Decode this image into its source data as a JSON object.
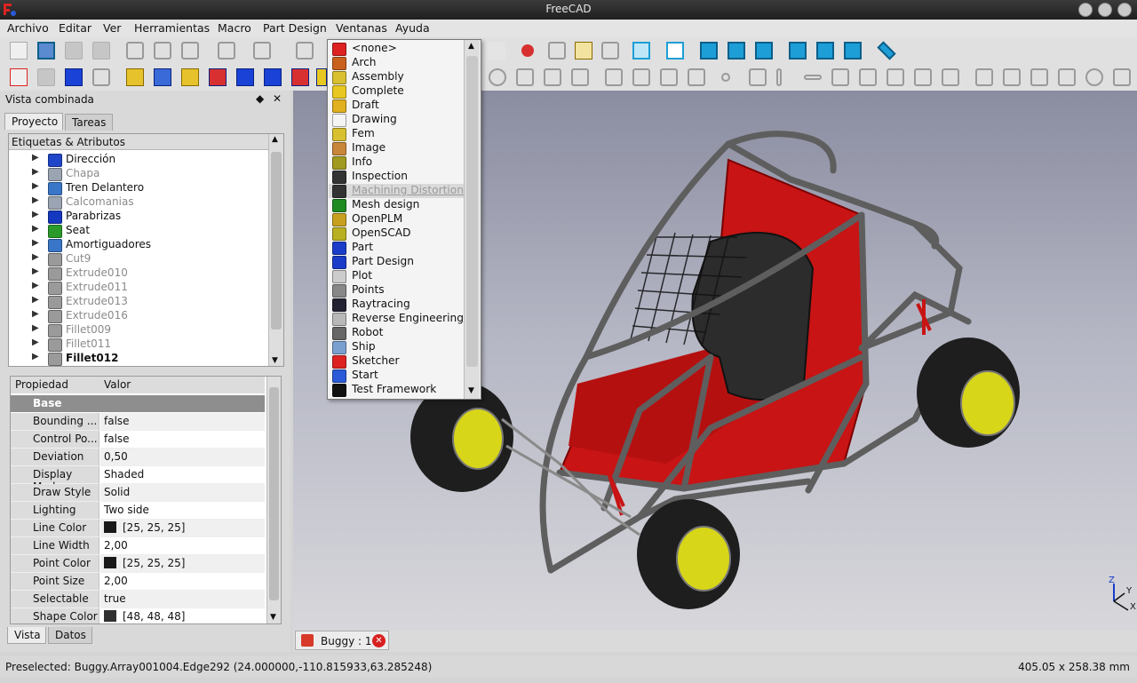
{
  "window": {
    "title": "FreeCAD"
  },
  "menubar": [
    "Archivo",
    "Editar",
    "Ver",
    "Herramientas",
    "Macro",
    "Part Design",
    "Ventanas",
    "Ayuda"
  ],
  "combo": {
    "title": "Vista combinada",
    "tabs": [
      "Proyecto",
      "Tareas"
    ],
    "tree_header": "Etiquetas & Atributos",
    "tree_items": [
      {
        "label": "Dirección",
        "icon_color": "#1f45c8",
        "dim": false
      },
      {
        "label": "Chapa",
        "icon_color": "#9aa4b2",
        "dim": true
      },
      {
        "label": "Tren Delantero",
        "icon_color": "#3a76c8",
        "dim": false
      },
      {
        "label": "Calcomanias",
        "icon_color": "#9aa4b2",
        "dim": true
      },
      {
        "label": "Parabrizas",
        "icon_color": "#1538c0",
        "dim": false
      },
      {
        "label": "Seat",
        "icon_color": "#2a9a2a",
        "dim": false
      },
      {
        "label": "Amortiguadores",
        "icon_color": "#3a76c8",
        "dim": false
      },
      {
        "label": "Cut9",
        "icon_color": "#9a9a9a",
        "dim": true
      },
      {
        "label": "Extrude010",
        "icon_color": "#9a9a9a",
        "dim": true
      },
      {
        "label": "Extrude011",
        "icon_color": "#9a9a9a",
        "dim": true
      },
      {
        "label": "Extrude013",
        "icon_color": "#9a9a9a",
        "dim": true
      },
      {
        "label": "Extrude016",
        "icon_color": "#9a9a9a",
        "dim": true
      },
      {
        "label": "Fillet009",
        "icon_color": "#9a9a9a",
        "dim": true
      },
      {
        "label": "Fillet011",
        "icon_color": "#9a9a9a",
        "dim": true
      },
      {
        "label": "Fillet012",
        "icon_color": "#9a9a9a",
        "dim": false,
        "bold": true
      }
    ],
    "prop_headers": [
      "Propiedad",
      "Valor"
    ],
    "prop_group": "Base",
    "props": [
      {
        "key": "Bounding ...",
        "value": "false"
      },
      {
        "key": "Control Po...",
        "value": "false"
      },
      {
        "key": "Deviation",
        "value": "0,50"
      },
      {
        "key": "Display Mode",
        "value": "Shaded"
      },
      {
        "key": "Draw Style",
        "value": "Solid"
      },
      {
        "key": "Lighting",
        "value": "Two side"
      },
      {
        "key": "Line Color",
        "value": "[25, 25, 25]",
        "swatch": "#191919"
      },
      {
        "key": "Line Width",
        "value": "2,00"
      },
      {
        "key": "Point Color",
        "value": "[25, 25, 25]",
        "swatch": "#191919"
      },
      {
        "key": "Point Size",
        "value": "2,00"
      },
      {
        "key": "Selectable",
        "value": "true"
      },
      {
        "key": "Shape Color",
        "value": "[48, 48, 48]",
        "swatch": "#303030"
      }
    ],
    "bottom_tabs": [
      "Vista",
      "Datos"
    ]
  },
  "workbench_dropdown": {
    "items": [
      "<none>",
      "Arch",
      "Assembly",
      "Complete",
      "Draft",
      "Drawing",
      "Fem",
      "Image",
      "Info",
      "Inspection",
      "Machining Distortion",
      "Mesh design",
      "OpenPLM",
      "OpenSCAD",
      "Part",
      "Part Design",
      "Plot",
      "Points",
      "Raytracing",
      "Reverse Engineering",
      "Robot",
      "Ship",
      "Sketcher",
      "Start",
      "Test Framework"
    ],
    "icon_colors": [
      "#d22",
      "#c8621e",
      "#d8c030",
      "#e8c820",
      "#e0b020",
      "#f4f4f4",
      "#d8c030",
      "#c8863a",
      "#a09a20",
      "#333",
      "#333",
      "#1f8a1f",
      "#c8a020",
      "#b8b020",
      "#1a3cc8",
      "#1a3cc8",
      "#ccc",
      "#888",
      "#223",
      "#b8b8b8",
      "#666",
      "#7aa0d0",
      "#d22",
      "#2a5ad8",
      "#111"
    ],
    "selected": 10
  },
  "document_tab": {
    "label": "Buggy : 1"
  },
  "statusbar": {
    "message": "Preselected: Buggy.Array001004.Edge292 (24.000000,-110.815933,63.285248)",
    "dimensions": "405.05 x 258.38 mm"
  },
  "axis": {
    "x": "X",
    "y": "Y",
    "z": "Z"
  }
}
